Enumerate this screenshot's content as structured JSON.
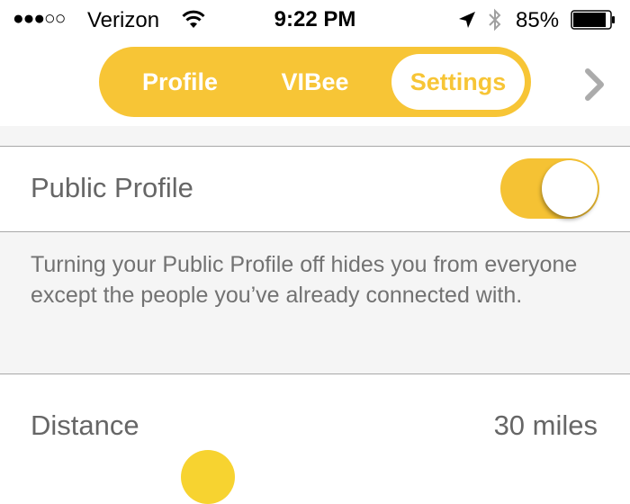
{
  "status_bar": {
    "signal": "●●●○○",
    "carrier": "Verizon",
    "time": "9:22 PM",
    "battery_percent": "85%",
    "icons": [
      "wifi-icon",
      "location-arrow-icon",
      "bluetooth-icon",
      "battery-icon"
    ]
  },
  "nav": {
    "tabs": [
      {
        "label": "Profile",
        "selected": false
      },
      {
        "label": "VIBee",
        "selected": false
      },
      {
        "label": "Settings",
        "selected": true
      }
    ],
    "next_icon": "chevron-right-icon"
  },
  "settings": {
    "public_profile": {
      "label": "Public Profile",
      "enabled": true,
      "description": "Turning your Public Profile off hides you from everyone except the people you’ve already connected with."
    },
    "distance": {
      "label": "Distance",
      "value": "30 miles"
    }
  },
  "colors": {
    "accent": "#f7c536",
    "toggle_on": "#f5c234",
    "slider_thumb": "#f7d330",
    "label_text": "#666666",
    "description_text": "#727272",
    "section_bg": "#f5f5f5"
  }
}
